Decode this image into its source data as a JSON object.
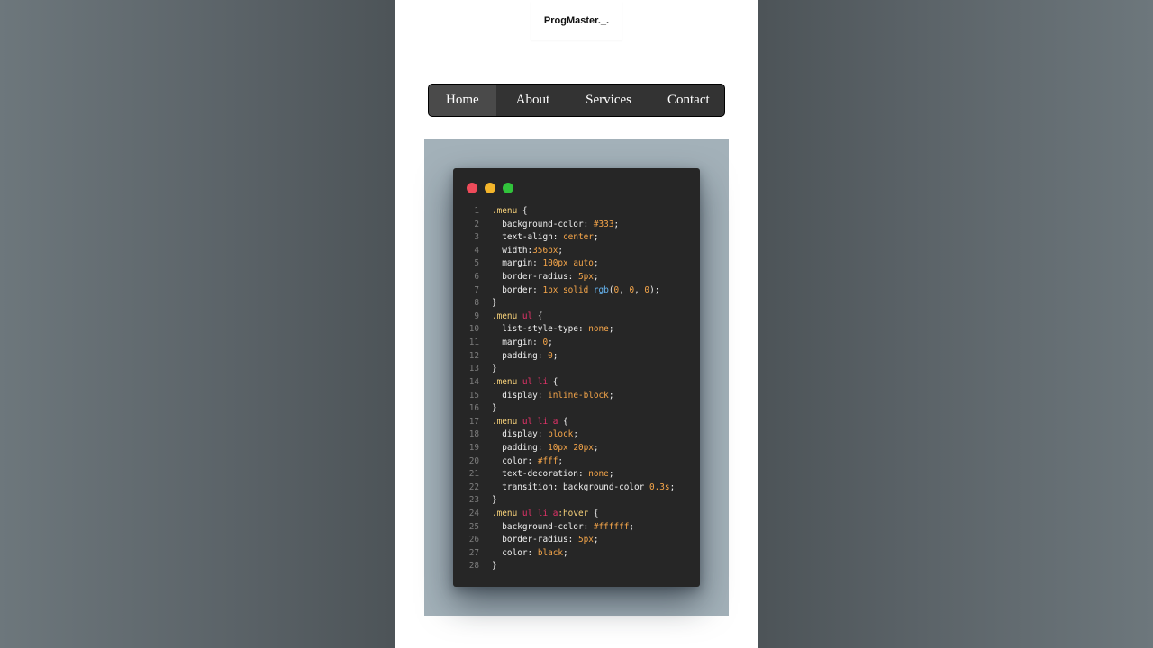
{
  "brand": {
    "text": "ProgMaster._."
  },
  "menu": {
    "items": [
      {
        "label": "Home",
        "active": true
      },
      {
        "label": "About",
        "active": false
      },
      {
        "label": "Services",
        "active": false
      },
      {
        "label": "Contact",
        "active": false
      }
    ]
  },
  "colors": {
    "menu_bg": "#333333",
    "menu_active_bg": "#4a4a4a",
    "code_bg": "#262626",
    "backdrop": "#a3b1b9",
    "dot_red": "#ee4b5a",
    "dot_yellow": "#f3b52b",
    "dot_green": "#31c33b"
  },
  "code": {
    "lines": [
      [
        [
          "sel",
          ".menu"
        ],
        [
          "p",
          " {"
        ]
      ],
      [
        [
          "prop",
          "  background-color: "
        ],
        [
          "val",
          "#333"
        ],
        [
          "p",
          ";"
        ]
      ],
      [
        [
          "prop",
          "  text-align: "
        ],
        [
          "val",
          "center"
        ],
        [
          "p",
          ";"
        ]
      ],
      [
        [
          "prop",
          "  width:"
        ],
        [
          "val",
          "356px"
        ],
        [
          "p",
          ";"
        ]
      ],
      [
        [
          "prop",
          "  margin: "
        ],
        [
          "val",
          "100px auto"
        ],
        [
          "p",
          ";"
        ]
      ],
      [
        [
          "prop",
          "  border-radius: "
        ],
        [
          "val",
          "5px"
        ],
        [
          "p",
          ";"
        ]
      ],
      [
        [
          "prop",
          "  border: "
        ],
        [
          "val",
          "1px solid "
        ],
        [
          "fn",
          "rgb"
        ],
        [
          "p",
          "("
        ],
        [
          "val",
          "0"
        ],
        [
          "p",
          ", "
        ],
        [
          "val",
          "0"
        ],
        [
          "p",
          ", "
        ],
        [
          "val",
          "0"
        ],
        [
          "p",
          ");"
        ]
      ],
      [
        [
          "p",
          "}"
        ]
      ],
      [
        [
          "sel",
          ".menu "
        ],
        [
          "tag",
          "ul"
        ],
        [
          "p",
          " {"
        ]
      ],
      [
        [
          "prop",
          "  list-style-type: "
        ],
        [
          "val",
          "none"
        ],
        [
          "p",
          ";"
        ]
      ],
      [
        [
          "prop",
          "  margin: "
        ],
        [
          "val",
          "0"
        ],
        [
          "p",
          ";"
        ]
      ],
      [
        [
          "prop",
          "  padding: "
        ],
        [
          "val",
          "0"
        ],
        [
          "p",
          ";"
        ]
      ],
      [
        [
          "p",
          "}"
        ]
      ],
      [
        [
          "sel",
          ".menu "
        ],
        [
          "tag",
          "ul li"
        ],
        [
          "p",
          " {"
        ]
      ],
      [
        [
          "prop",
          "  display: "
        ],
        [
          "val",
          "inline-block"
        ],
        [
          "p",
          ";"
        ]
      ],
      [
        [
          "p",
          "}"
        ]
      ],
      [
        [
          "sel",
          ".menu "
        ],
        [
          "tag",
          "ul li a"
        ],
        [
          "p",
          " {"
        ]
      ],
      [
        [
          "prop",
          "  display: "
        ],
        [
          "val",
          "block"
        ],
        [
          "p",
          ";"
        ]
      ],
      [
        [
          "prop",
          "  padding: "
        ],
        [
          "val",
          "10px 20px"
        ],
        [
          "p",
          ";"
        ]
      ],
      [
        [
          "prop",
          "  color: "
        ],
        [
          "val",
          "#fff"
        ],
        [
          "p",
          ";"
        ]
      ],
      [
        [
          "prop",
          "  text-decoration: "
        ],
        [
          "val",
          "none"
        ],
        [
          "p",
          ";"
        ]
      ],
      [
        [
          "prop",
          "  transition: background-color "
        ],
        [
          "val",
          "0.3s"
        ],
        [
          "p",
          ";"
        ]
      ],
      [
        [
          "p",
          "}"
        ]
      ],
      [
        [
          "sel",
          ".menu "
        ],
        [
          "tag",
          "ul li a"
        ],
        [
          "sel",
          ":hover"
        ],
        [
          "p",
          " {"
        ]
      ],
      [
        [
          "prop",
          "  background-color: "
        ],
        [
          "val",
          "#ffffff"
        ],
        [
          "p",
          ";"
        ]
      ],
      [
        [
          "prop",
          "  border-radius: "
        ],
        [
          "val",
          "5px"
        ],
        [
          "p",
          ";"
        ]
      ],
      [
        [
          "prop",
          "  color: "
        ],
        [
          "val",
          "black"
        ],
        [
          "p",
          ";"
        ]
      ],
      [
        [
          "p",
          "}"
        ]
      ]
    ]
  }
}
